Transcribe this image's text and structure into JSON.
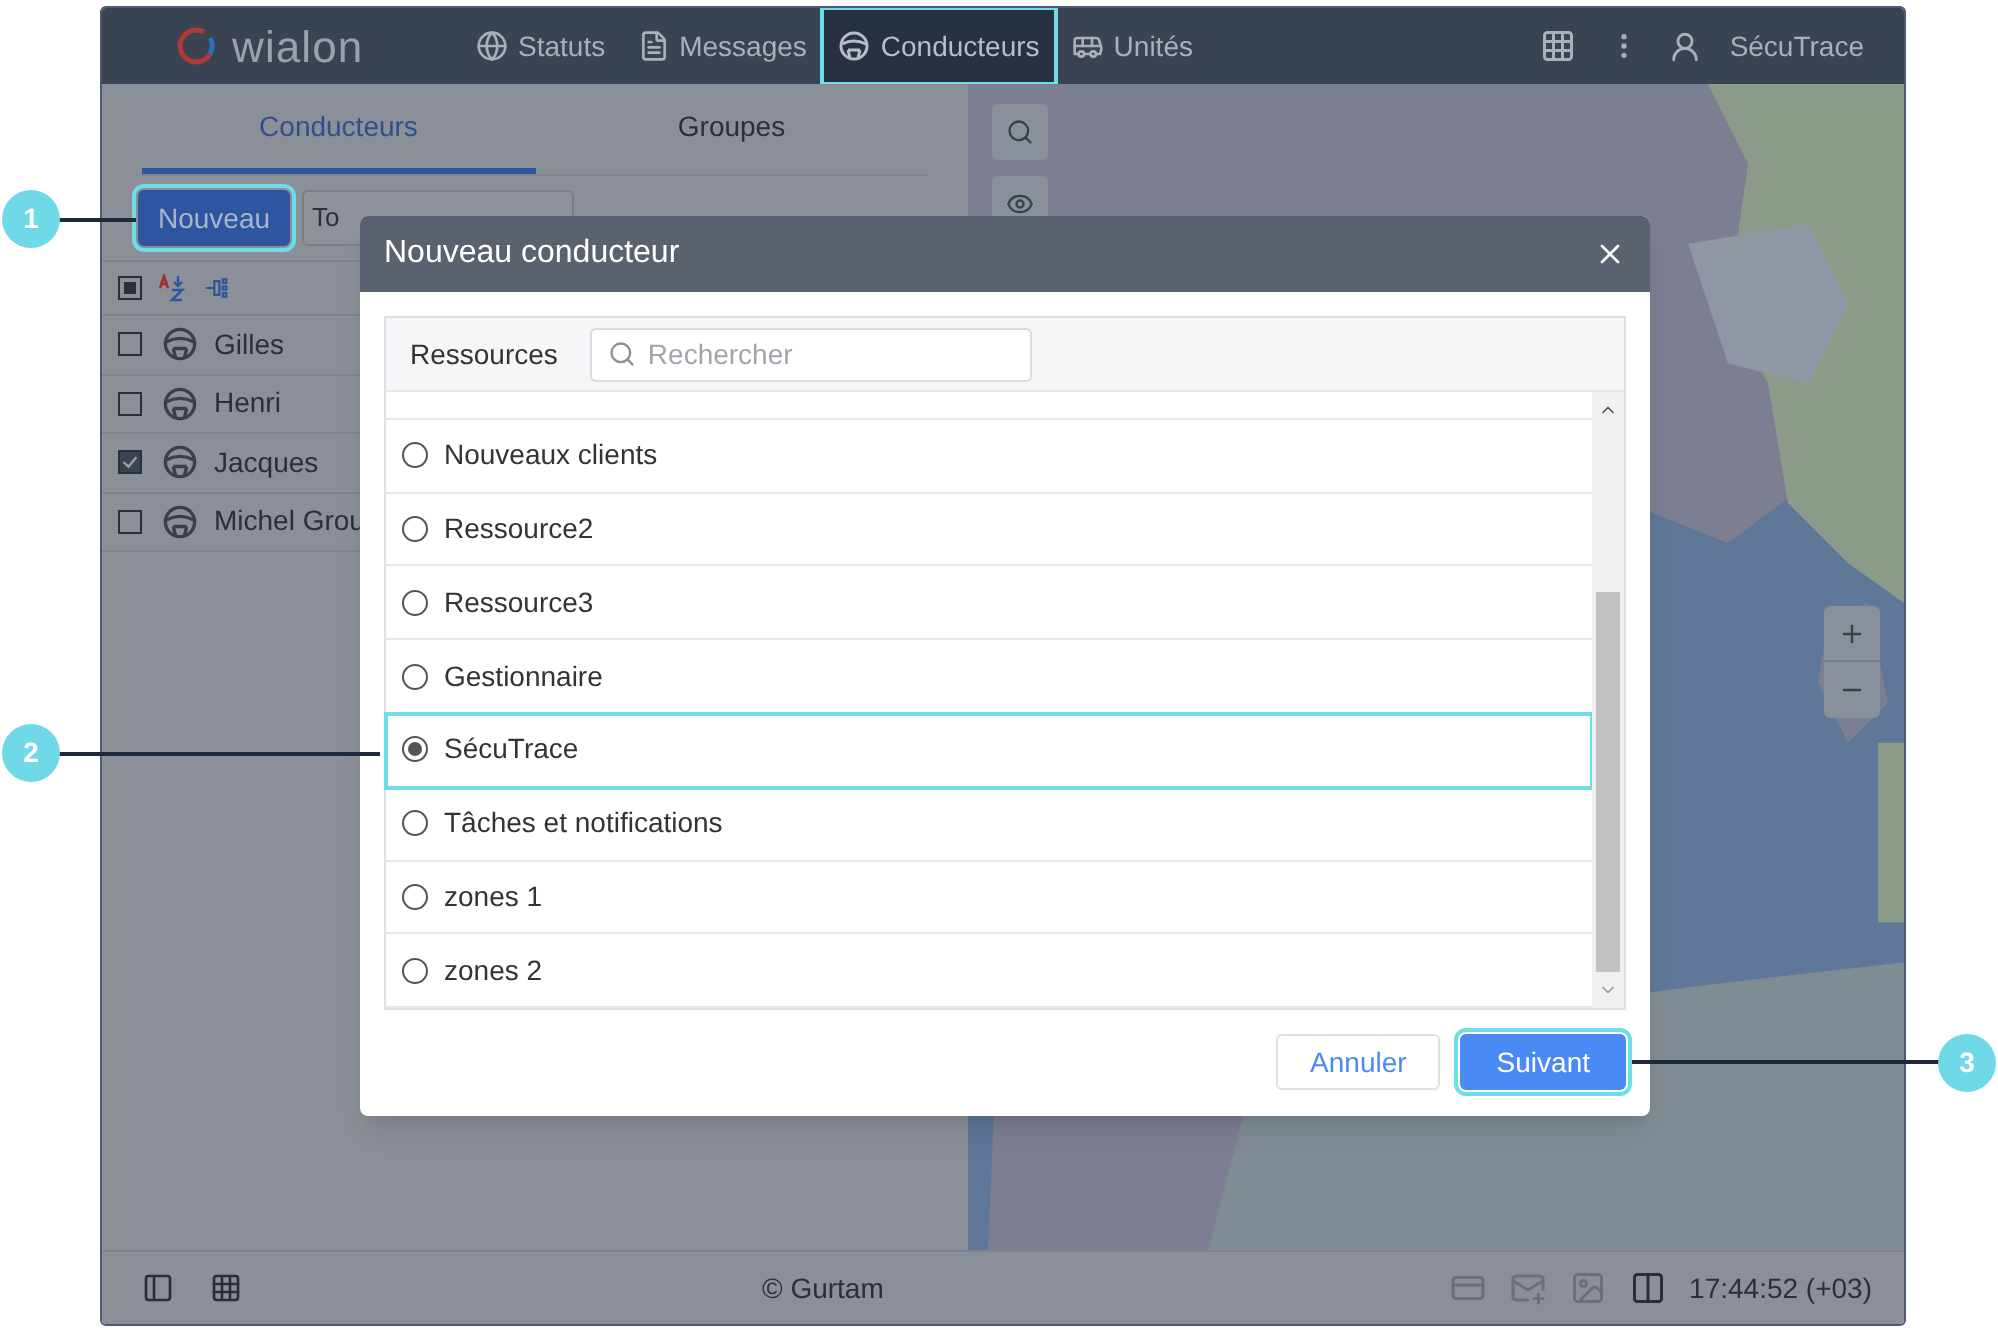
{
  "header": {
    "logo": "wialon",
    "nav": [
      {
        "label": "Statuts",
        "kind": "globe",
        "selected": false
      },
      {
        "label": "Messages",
        "kind": "document",
        "selected": false
      },
      {
        "label": "Conducteurs",
        "kind": "wheel",
        "selected": true
      },
      {
        "label": "Unités",
        "kind": "bus",
        "selected": false
      }
    ],
    "user": "SécuTrace"
  },
  "left_panel": {
    "tabs": [
      {
        "label": "Conducteurs",
        "selected": true
      },
      {
        "label": "Groupes",
        "selected": false
      }
    ],
    "new_button": "Nouveau",
    "filter": "To",
    "select_all": {
      "indeterminate": true
    },
    "drivers": [
      {
        "name": "Gilles",
        "checked": false
      },
      {
        "name": "Henri",
        "checked": false
      },
      {
        "name": "Jacques",
        "checked": true
      },
      {
        "name": "Michel Grou",
        "checked": false
      }
    ]
  },
  "map": {
    "kind": "picture"
  },
  "dialog": {
    "title": "Nouveau conducteur",
    "resources_label": "Ressources",
    "search": {
      "placeholder": "Rechercher"
    },
    "resources": [
      {
        "name": "Nouveaux clients",
        "selected": false
      },
      {
        "name": "Ressource2",
        "selected": false
      },
      {
        "name": "Ressource3",
        "selected": false
      },
      {
        "name": "Gestionnaire",
        "selected": false
      },
      {
        "name": "SécuTrace",
        "selected": true
      },
      {
        "name": "Tâches et notifications",
        "selected": false
      },
      {
        "name": "zones 1",
        "selected": false
      },
      {
        "name": "zones 2",
        "selected": false
      }
    ],
    "buttons": [
      "Annuler",
      "Suivant"
    ]
  },
  "footer": {
    "copyright": "© Gurtam",
    "time": "17:44:52 (+03)"
  },
  "callouts": [
    "1",
    "2",
    "3"
  ]
}
